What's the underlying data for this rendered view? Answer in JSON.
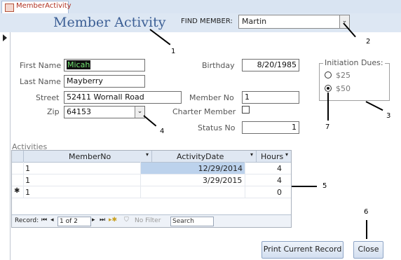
{
  "tab": {
    "label": "MemberActivity"
  },
  "header": {
    "title": "Member Activity",
    "find_label": "FIND MEMBER:",
    "find_value": "Martin"
  },
  "form": {
    "first_name_label": "First Name",
    "first_name": "Micah",
    "last_name_label": "Last Name",
    "last_name": "Mayberry",
    "street_label": "Street",
    "street": "52411 Wornall Road",
    "zip_label": "Zip",
    "zip": "64153",
    "birthday_label": "Birthday",
    "birthday": "8/20/1985",
    "member_no_label": "Member No",
    "member_no": "1",
    "charter_label": "Charter Member",
    "status_label": "Status No",
    "status_no": "1"
  },
  "dues": {
    "label": "Initiation Dues:",
    "options": [
      "$25",
      "$50"
    ],
    "selected": "$50"
  },
  "activities": {
    "label": "Activities",
    "columns": [
      "MemberNo",
      "ActivityDate",
      "Hours"
    ],
    "rows": [
      {
        "member_no": "1",
        "date": "12/29/2014",
        "hours": "4"
      },
      {
        "member_no": "1",
        "date": "3/29/2015",
        "hours": "4"
      },
      {
        "member_no": "1",
        "date": "",
        "hours": "0"
      }
    ],
    "new_row_marker": "✱",
    "nav": {
      "record_label": "Record:",
      "position": "1 of 2",
      "filter_label": "No Filter",
      "search_placeholder": "Search"
    }
  },
  "buttons": {
    "print": "Print Current Record",
    "close": "Close"
  },
  "callouts": [
    "1",
    "2",
    "3",
    "4",
    "5",
    "6",
    "7"
  ]
}
